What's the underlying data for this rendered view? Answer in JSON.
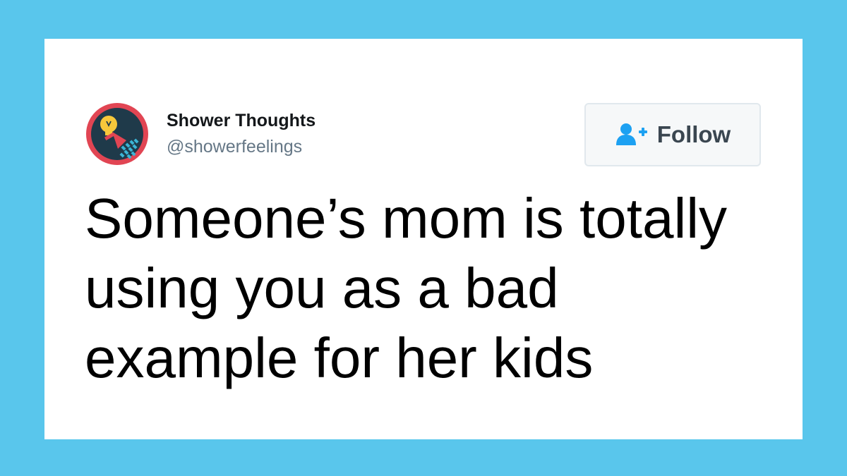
{
  "page": {
    "background_color": "#59c6ec",
    "card_color": "#ffffff"
  },
  "account": {
    "name": "Shower Thoughts",
    "handle": "@showerfeelings",
    "avatar_icon": "lightbulb-shower-icon",
    "avatar_colors": {
      "ring": "#e14553",
      "background": "#1f3a4a",
      "bulb": "#f7c83b",
      "water": "#3bb5d6"
    }
  },
  "follow_button": {
    "label": "Follow",
    "icon": "add-user-icon",
    "icon_color": "#1da1f2"
  },
  "tweet": {
    "text": "Someone’s mom is totally using you as a bad example for her kids"
  }
}
